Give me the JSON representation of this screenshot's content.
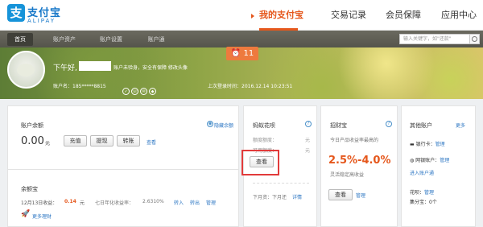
{
  "logo": {
    "mark": "支",
    "cn": "支付宝",
    "en": "ALIPAY"
  },
  "nav": {
    "my_alipay": "我的支付宝",
    "transactions": "交易记录",
    "member": "会员保障",
    "apps": "应用中心"
  },
  "tabs": [
    "首页",
    "账户资产",
    "账户设置",
    "账户通"
  ],
  "search": {
    "placeholder": "输入关键字，如\"还款\""
  },
  "notification": {
    "icon": "alarm-icon",
    "count": "11"
  },
  "user": {
    "greeting": "下午好,",
    "greeting_tail": "  账户未验身，安全有保障 修改头像",
    "account_label": "账户名：",
    "account": "185*****8815",
    "last_login_label": "上次登录时间：",
    "last_login": "2016.12.14  10:23:51"
  },
  "balance": {
    "title": "账户余额",
    "show_label": "隐藏余额",
    "amount": "0.00",
    "unit": "元",
    "recharge": "充值",
    "withdraw": "提现",
    "transfer": "转账",
    "view": "查看"
  },
  "yuebao": {
    "title": "余额宝",
    "date_label": "12月13日收益：",
    "earnings": "0.14",
    "earnings_unit": "元",
    "rate_label": "七日年化收益率：",
    "rate": "2.6310%",
    "transfer_in": "转入",
    "transfer_out": "转出",
    "manage": "管理",
    "more": "更多理财"
  },
  "huabei": {
    "title": "蚂蚁花呗",
    "line1": "额度额度：",
    "line1_unit": "元",
    "line2": "可用额度：",
    "line2_unit": "元",
    "view": "查看",
    "next_label": "下月资：下月还",
    "next_link": "详情"
  },
  "zhaocai": {
    "title": "招财宝",
    "desc": "今日产品收益率最高的",
    "rate": "2.5%-4.0%",
    "tip": "灵活稳定高收益",
    "view": "查看",
    "manage": "管理"
  },
  "other": {
    "title": "其他账户",
    "more": "更多",
    "bank_label": "银行卡：",
    "bank_link": "管理",
    "net_label": "网银账户：",
    "net_link": "管理",
    "transfer_link": "进入账户通",
    "huabei_label": "花呗：",
    "huabei_link": "管理",
    "credit_label": "集分宝：",
    "credit_value": "0个"
  }
}
